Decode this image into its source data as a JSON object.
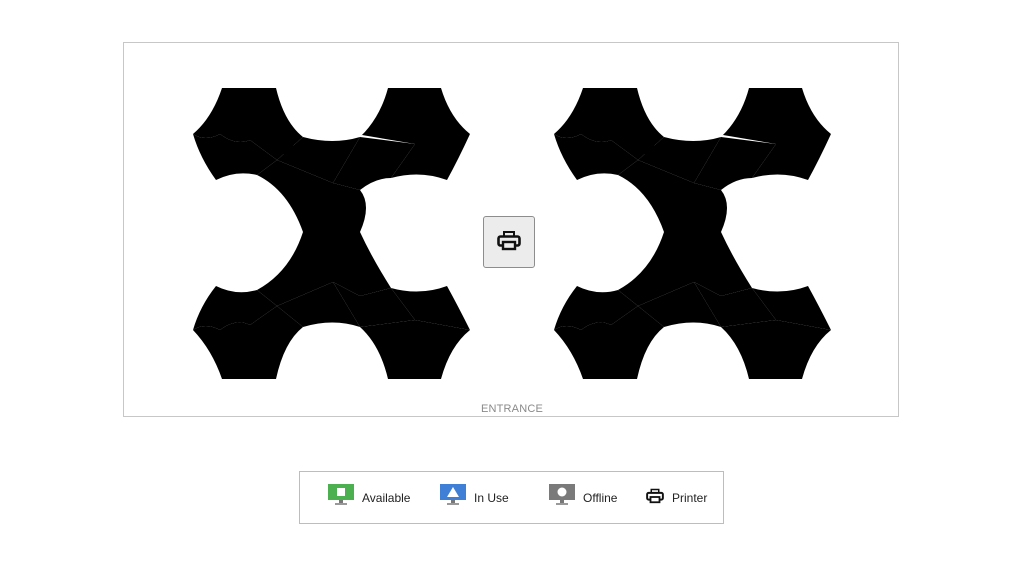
{
  "floor": {
    "entrance_label": "ENTRANCE",
    "pods": [
      "pod-left",
      "pod-right"
    ],
    "desk_fill": "#f0f0f0",
    "desk_stroke": "#3a3a3a"
  },
  "printer": {
    "icon": "printer-icon"
  },
  "legend": {
    "items": [
      {
        "label": "Available",
        "icon": "monitor-available-icon",
        "color": "#4caf50"
      },
      {
        "label": "In Use",
        "icon": "monitor-in-use-icon",
        "color": "#3f7fd6"
      },
      {
        "label": "Offline",
        "icon": "monitor-offline-icon",
        "color": "#7a7a7a"
      },
      {
        "label": "Printer",
        "icon": "printer-icon",
        "color": "#111111"
      }
    ]
  }
}
